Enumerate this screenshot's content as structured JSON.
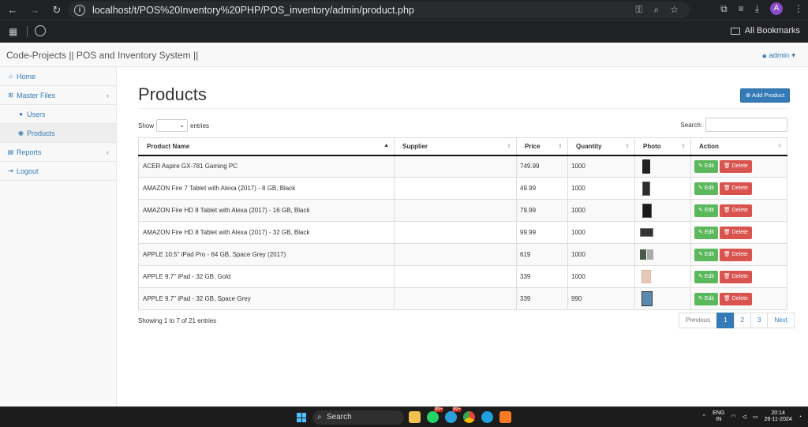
{
  "browser": {
    "url": "localhost/t/POS%20Inventory%20PHP/POS_inventory/admin/product.php",
    "profile_initial": "A",
    "all_bookmarks": "All Bookmarks"
  },
  "navbar": {
    "brand": "Code-Projects || POS and Inventory System ||",
    "user": "admin"
  },
  "sidebar": {
    "items": [
      {
        "label": "Home",
        "icon": "home-icon"
      },
      {
        "label": "Master Files",
        "icon": "sitemap-icon"
      },
      {
        "label": "Users",
        "icon": "user-icon"
      },
      {
        "label": "Products",
        "icon": "product-icon"
      },
      {
        "label": "Reports",
        "icon": "reports-icon"
      },
      {
        "label": "Logout",
        "icon": "logout-icon"
      }
    ]
  },
  "main": {
    "title": "Products",
    "add_button": "Add Product",
    "show_label": "Show",
    "entries_label": "entries",
    "search_label": "Search:",
    "search_value": "",
    "columns": [
      "Product Name",
      "Supplier",
      "Price",
      "Quantity",
      "Photo",
      "Action"
    ],
    "rows": [
      {
        "name": "ACER Aspire GX-781 Gaming PC",
        "supplier": "",
        "price": "749.99",
        "quantity": "1000"
      },
      {
        "name": "AMAZON Fire 7 Tablet with Alexa (2017) - 8 GB, Black",
        "supplier": "",
        "price": "49.99",
        "quantity": "1000"
      },
      {
        "name": "AMAZON Fire HD 8 Tablet with Alexa (2017) - 16 GB, Black",
        "supplier": "",
        "price": "79.99",
        "quantity": "1000"
      },
      {
        "name": "AMAZON Fire HD 8 Tablet with Alexa (2017) - 32 GB, Black",
        "supplier": "",
        "price": "99.99",
        "quantity": "1000"
      },
      {
        "name": "APPLE 10.5\" iPad Pro - 64 GB, Space Grey (2017)",
        "supplier": "",
        "price": "619",
        "quantity": "1000"
      },
      {
        "name": "APPLE 9.7\" iPad - 32 GB, Gold",
        "supplier": "",
        "price": "339",
        "quantity": "1000"
      },
      {
        "name": "APPLE 9.7\" iPad - 32 GB, Space Grey",
        "supplier": "",
        "price": "339",
        "quantity": "990"
      }
    ],
    "edit_label": "Edit",
    "delete_label": "Delete",
    "info": "Showing 1 to 7 of 21 entries",
    "pagination": [
      "Previous",
      "1",
      "2",
      "3",
      "Next"
    ]
  },
  "taskbar": {
    "search": "Search",
    "lang_top": "ENG",
    "lang_bottom": "IN",
    "time": "20:14",
    "date": "26-11-2024",
    "badge": "99+"
  },
  "colors": {
    "primary": "#337ab7",
    "edit": "#5cb85c",
    "delete": "#d9534f"
  }
}
